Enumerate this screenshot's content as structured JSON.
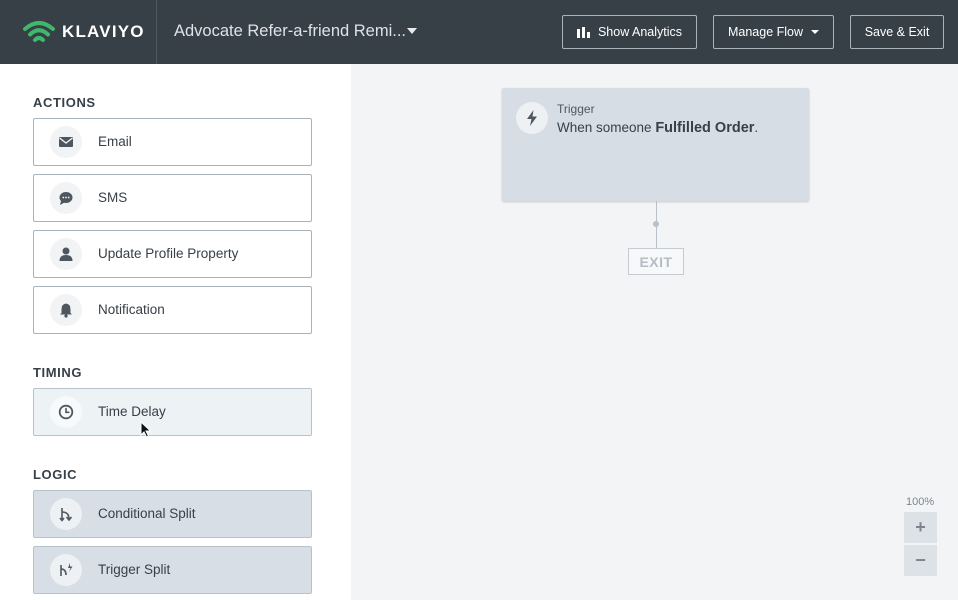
{
  "header": {
    "brand": "KLAVIYO",
    "flow_title": "Advocate Refer-a-friend Remi...",
    "buttons": {
      "analytics": "Show Analytics",
      "manage": "Manage Flow",
      "save": "Save & Exit"
    }
  },
  "sidebar": {
    "sections": {
      "actions": "ACTIONS",
      "timing": "TIMING",
      "logic": "LOGIC"
    },
    "actions": [
      {
        "label": "Email",
        "icon": "envelope-icon"
      },
      {
        "label": "SMS",
        "icon": "chat-bubble-icon"
      },
      {
        "label": "Update Profile Property",
        "icon": "person-icon"
      },
      {
        "label": "Notification",
        "icon": "bell-icon"
      }
    ],
    "timing": [
      {
        "label": "Time Delay",
        "icon": "clock-icon"
      }
    ],
    "logic": [
      {
        "label": "Conditional Split",
        "icon": "split-icon"
      },
      {
        "label": "Trigger Split",
        "icon": "trigger-split-icon"
      }
    ]
  },
  "canvas": {
    "trigger": {
      "label": "Trigger",
      "prefix": "When someone ",
      "event": "Fulfilled Order",
      "suffix": "."
    },
    "exit_label": "EXIT",
    "zoom": "100%",
    "zoom_in": "+",
    "zoom_out": "−"
  },
  "colors": {
    "header_bg": "#373f47",
    "logo_green": "#3fb86b",
    "trigger_card": "#d6dde5",
    "logic_card": "#d8dee5"
  }
}
